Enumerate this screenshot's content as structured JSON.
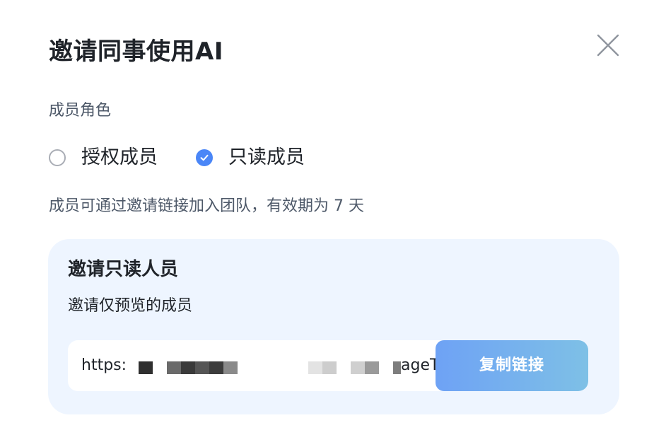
{
  "dialog": {
    "title": "邀请同事使用AI",
    "close_icon": "close-icon"
  },
  "role": {
    "label": "成员角色",
    "options": [
      {
        "label": "授权成员",
        "checked": false
      },
      {
        "label": "只读成员",
        "checked": true
      }
    ]
  },
  "hint": "成员可通过邀请链接加入团队，有效期为 7 天",
  "invite_card": {
    "title": "邀请只读人员",
    "description": "邀请仅预览的成员",
    "link_start": "https:",
    "link_end": "ageTy",
    "copy_button_label": "复制链接"
  },
  "colors": {
    "accent": "#4a86f7",
    "card_background": "#eef5ff",
    "button_gradient_start": "#6ea2f5",
    "button_gradient_end": "#7ec0e6"
  }
}
